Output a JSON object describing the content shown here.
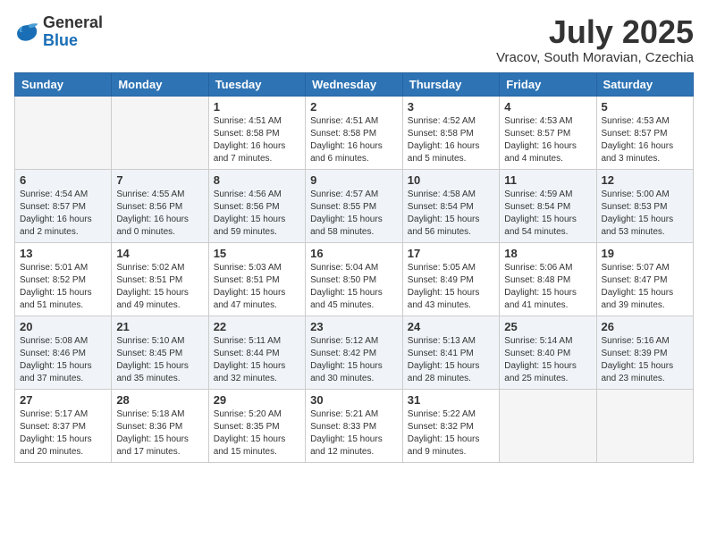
{
  "header": {
    "logo_general": "General",
    "logo_blue": "Blue",
    "month_year": "July 2025",
    "location": "Vracov, South Moravian, Czechia"
  },
  "weekdays": [
    "Sunday",
    "Monday",
    "Tuesday",
    "Wednesday",
    "Thursday",
    "Friday",
    "Saturday"
  ],
  "weeks": [
    [
      {
        "day": "",
        "empty": true
      },
      {
        "day": "",
        "empty": true
      },
      {
        "day": "1",
        "sunrise": "4:51 AM",
        "sunset": "8:58 PM",
        "daylight": "16 hours and 7 minutes."
      },
      {
        "day": "2",
        "sunrise": "4:51 AM",
        "sunset": "8:58 PM",
        "daylight": "16 hours and 6 minutes."
      },
      {
        "day": "3",
        "sunrise": "4:52 AM",
        "sunset": "8:58 PM",
        "daylight": "16 hours and 5 minutes."
      },
      {
        "day": "4",
        "sunrise": "4:53 AM",
        "sunset": "8:57 PM",
        "daylight": "16 hours and 4 minutes."
      },
      {
        "day": "5",
        "sunrise": "4:53 AM",
        "sunset": "8:57 PM",
        "daylight": "16 hours and 3 minutes."
      }
    ],
    [
      {
        "day": "6",
        "sunrise": "4:54 AM",
        "sunset": "8:57 PM",
        "daylight": "16 hours and 2 minutes."
      },
      {
        "day": "7",
        "sunrise": "4:55 AM",
        "sunset": "8:56 PM",
        "daylight": "16 hours and 0 minutes."
      },
      {
        "day": "8",
        "sunrise": "4:56 AM",
        "sunset": "8:56 PM",
        "daylight": "15 hours and 59 minutes."
      },
      {
        "day": "9",
        "sunrise": "4:57 AM",
        "sunset": "8:55 PM",
        "daylight": "15 hours and 58 minutes."
      },
      {
        "day": "10",
        "sunrise": "4:58 AM",
        "sunset": "8:54 PM",
        "daylight": "15 hours and 56 minutes."
      },
      {
        "day": "11",
        "sunrise": "4:59 AM",
        "sunset": "8:54 PM",
        "daylight": "15 hours and 54 minutes."
      },
      {
        "day": "12",
        "sunrise": "5:00 AM",
        "sunset": "8:53 PM",
        "daylight": "15 hours and 53 minutes."
      }
    ],
    [
      {
        "day": "13",
        "sunrise": "5:01 AM",
        "sunset": "8:52 PM",
        "daylight": "15 hours and 51 minutes."
      },
      {
        "day": "14",
        "sunrise": "5:02 AM",
        "sunset": "8:51 PM",
        "daylight": "15 hours and 49 minutes."
      },
      {
        "day": "15",
        "sunrise": "5:03 AM",
        "sunset": "8:51 PM",
        "daylight": "15 hours and 47 minutes."
      },
      {
        "day": "16",
        "sunrise": "5:04 AM",
        "sunset": "8:50 PM",
        "daylight": "15 hours and 45 minutes."
      },
      {
        "day": "17",
        "sunrise": "5:05 AM",
        "sunset": "8:49 PM",
        "daylight": "15 hours and 43 minutes."
      },
      {
        "day": "18",
        "sunrise": "5:06 AM",
        "sunset": "8:48 PM",
        "daylight": "15 hours and 41 minutes."
      },
      {
        "day": "19",
        "sunrise": "5:07 AM",
        "sunset": "8:47 PM",
        "daylight": "15 hours and 39 minutes."
      }
    ],
    [
      {
        "day": "20",
        "sunrise": "5:08 AM",
        "sunset": "8:46 PM",
        "daylight": "15 hours and 37 minutes."
      },
      {
        "day": "21",
        "sunrise": "5:10 AM",
        "sunset": "8:45 PM",
        "daylight": "15 hours and 35 minutes."
      },
      {
        "day": "22",
        "sunrise": "5:11 AM",
        "sunset": "8:44 PM",
        "daylight": "15 hours and 32 minutes."
      },
      {
        "day": "23",
        "sunrise": "5:12 AM",
        "sunset": "8:42 PM",
        "daylight": "15 hours and 30 minutes."
      },
      {
        "day": "24",
        "sunrise": "5:13 AM",
        "sunset": "8:41 PM",
        "daylight": "15 hours and 28 minutes."
      },
      {
        "day": "25",
        "sunrise": "5:14 AM",
        "sunset": "8:40 PM",
        "daylight": "15 hours and 25 minutes."
      },
      {
        "day": "26",
        "sunrise": "5:16 AM",
        "sunset": "8:39 PM",
        "daylight": "15 hours and 23 minutes."
      }
    ],
    [
      {
        "day": "27",
        "sunrise": "5:17 AM",
        "sunset": "8:37 PM",
        "daylight": "15 hours and 20 minutes."
      },
      {
        "day": "28",
        "sunrise": "5:18 AM",
        "sunset": "8:36 PM",
        "daylight": "15 hours and 17 minutes."
      },
      {
        "day": "29",
        "sunrise": "5:20 AM",
        "sunset": "8:35 PM",
        "daylight": "15 hours and 15 minutes."
      },
      {
        "day": "30",
        "sunrise": "5:21 AM",
        "sunset": "8:33 PM",
        "daylight": "15 hours and 12 minutes."
      },
      {
        "day": "31",
        "sunrise": "5:22 AM",
        "sunset": "8:32 PM",
        "daylight": "15 hours and 9 minutes."
      },
      {
        "day": "",
        "empty": true
      },
      {
        "day": "",
        "empty": true
      }
    ]
  ]
}
